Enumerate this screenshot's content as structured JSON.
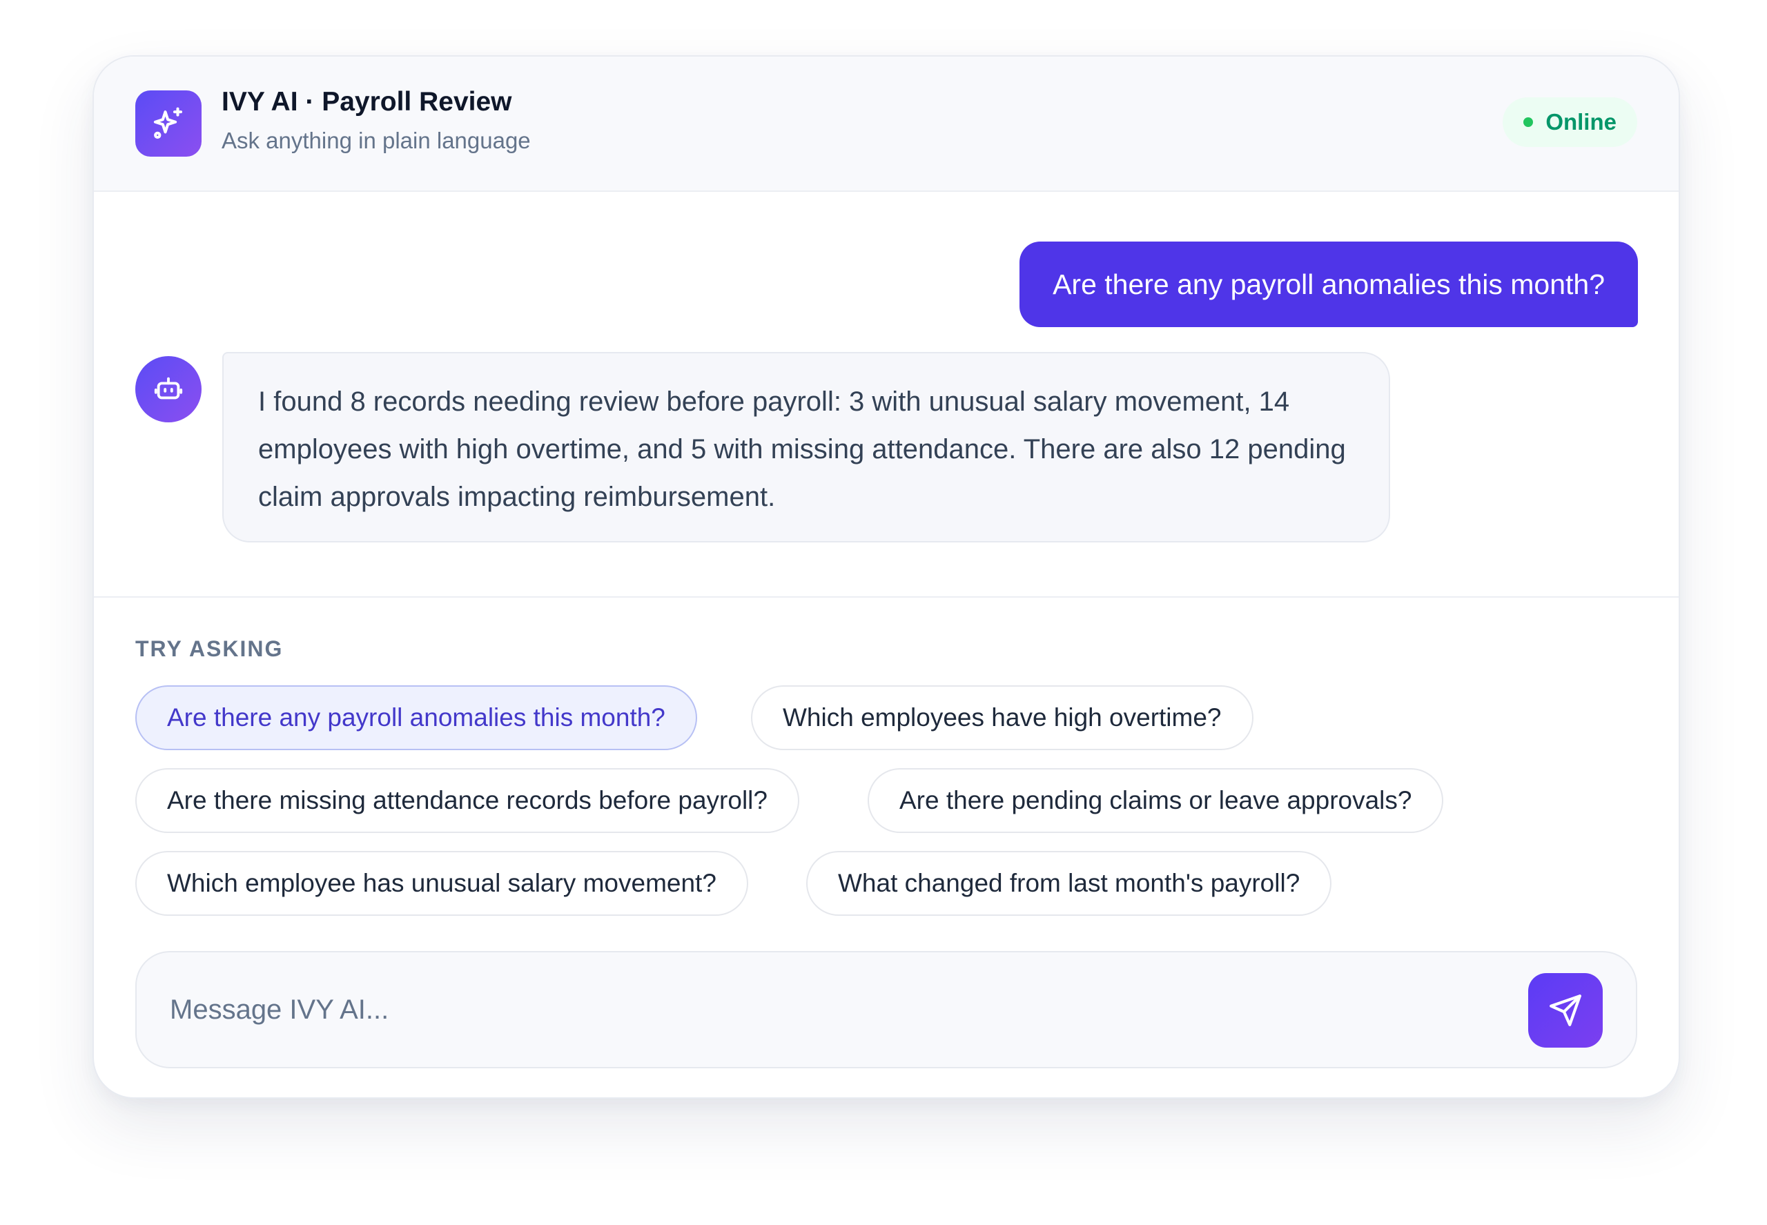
{
  "header": {
    "title": "IVY AI · Payroll Review",
    "subtitle": "Ask anything in plain language",
    "logo_icon": "sparkles-icon",
    "status": "Online"
  },
  "conversation": {
    "user_message": "Are there any payroll anomalies this month?",
    "assistant_avatar_icon": "robot-icon",
    "assistant_message": "I found 8 records needing review before payroll: 3 with unusual salary movement, 14 employees with high overtime, and 5 with missing attendance. There are also 12 pending claim approvals impacting reimbursement."
  },
  "suggestions": {
    "label": "TRY ASKING",
    "items": [
      "Are there any payroll anomalies this month?",
      "Which employees have high overtime?",
      "Are there missing attendance records before payroll?",
      "Are there pending claims or leave approvals?",
      "Which employee has unusual salary movement?",
      "What changed from last month's payroll?"
    ],
    "active": "Are there any payroll anomalies this month?"
  },
  "composer": {
    "value": "",
    "placeholder": "Message IVY AI...",
    "send_icon": "send-icon"
  },
  "colors": {
    "accent": "#4f35e8",
    "status_green": "#059669",
    "chip_active_text": "#4338ca"
  }
}
